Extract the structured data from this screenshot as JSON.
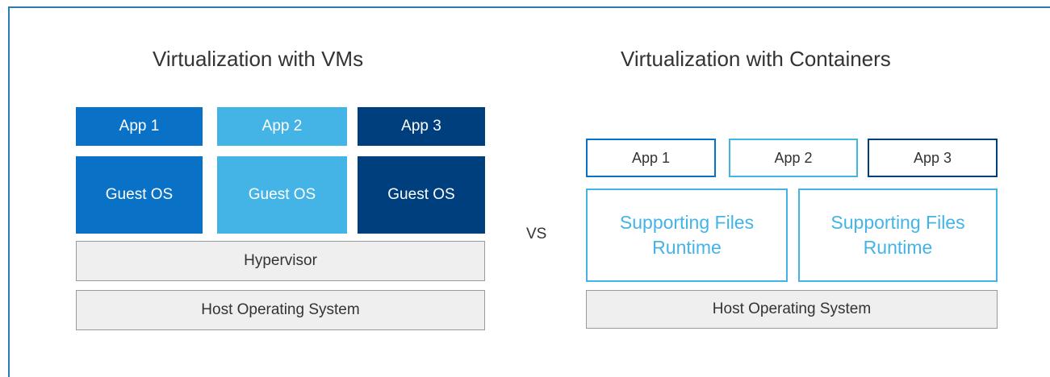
{
  "vm": {
    "title": "Virtualization with VMs",
    "apps": [
      "App 1",
      "App 2",
      "App 3"
    ],
    "guest_os": [
      "Guest OS",
      "Guest OS",
      "Guest OS"
    ],
    "hypervisor": "Hypervisor",
    "host_os": "Host Operating System",
    "colors": [
      "#0a72c6",
      "#44b4e6",
      "#003f7d"
    ]
  },
  "vs_label": "VS",
  "containers": {
    "title": "Virtualization with Containers",
    "apps": [
      "App 1",
      "App 2",
      "App 3"
    ],
    "supporting": [
      {
        "line1": "Supporting Files",
        "line2": "Runtime"
      },
      {
        "line1": "Supporting Files",
        "line2": "Runtime"
      }
    ],
    "host_os": "Host Operating System",
    "app_border_colors": [
      "#0a72c6",
      "#44b4e6",
      "#003f7d"
    ]
  }
}
